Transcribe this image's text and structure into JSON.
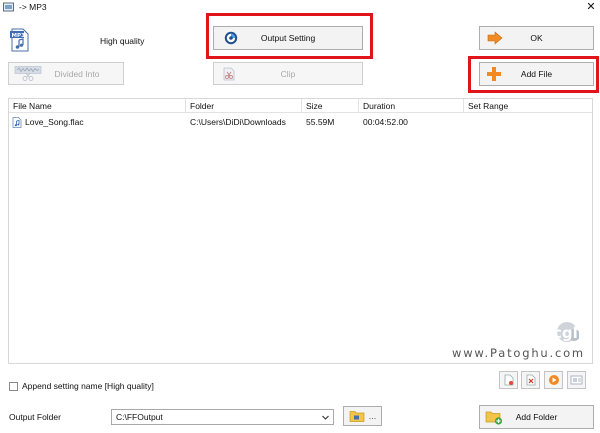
{
  "window": {
    "title": "-> MP3",
    "close_glyph": "✕"
  },
  "preset": {
    "label": "High quality",
    "icon": "mp3-file-icon"
  },
  "buttons": {
    "output_setting": "Output Setting",
    "ok": "OK",
    "divided_into": "Divided Into",
    "clip": "Clip",
    "add_file": "Add File",
    "add_folder": "Add Folder",
    "browse": "..."
  },
  "table": {
    "columns": [
      "File Name",
      "Folder",
      "Size",
      "Duration",
      "Set Range"
    ],
    "rows": [
      {
        "file_name": "Love_Song.flac",
        "folder": "C:\\Users\\DiDi\\Downloads",
        "size": "55.59M",
        "duration": "00:04:52.00",
        "set_range": ""
      }
    ]
  },
  "watermark": {
    "logo": "cgll",
    "text": "www.Patoghu.com"
  },
  "options": {
    "append_setting": "Append setting name [High quality]",
    "append_checked": false
  },
  "output": {
    "label": "Output Folder",
    "value": "C:\\FFOutput"
  },
  "colors": {
    "highlight": "#e0151b",
    "accent_orange": "#f08a24",
    "button_bg": "#f3f3f3"
  }
}
